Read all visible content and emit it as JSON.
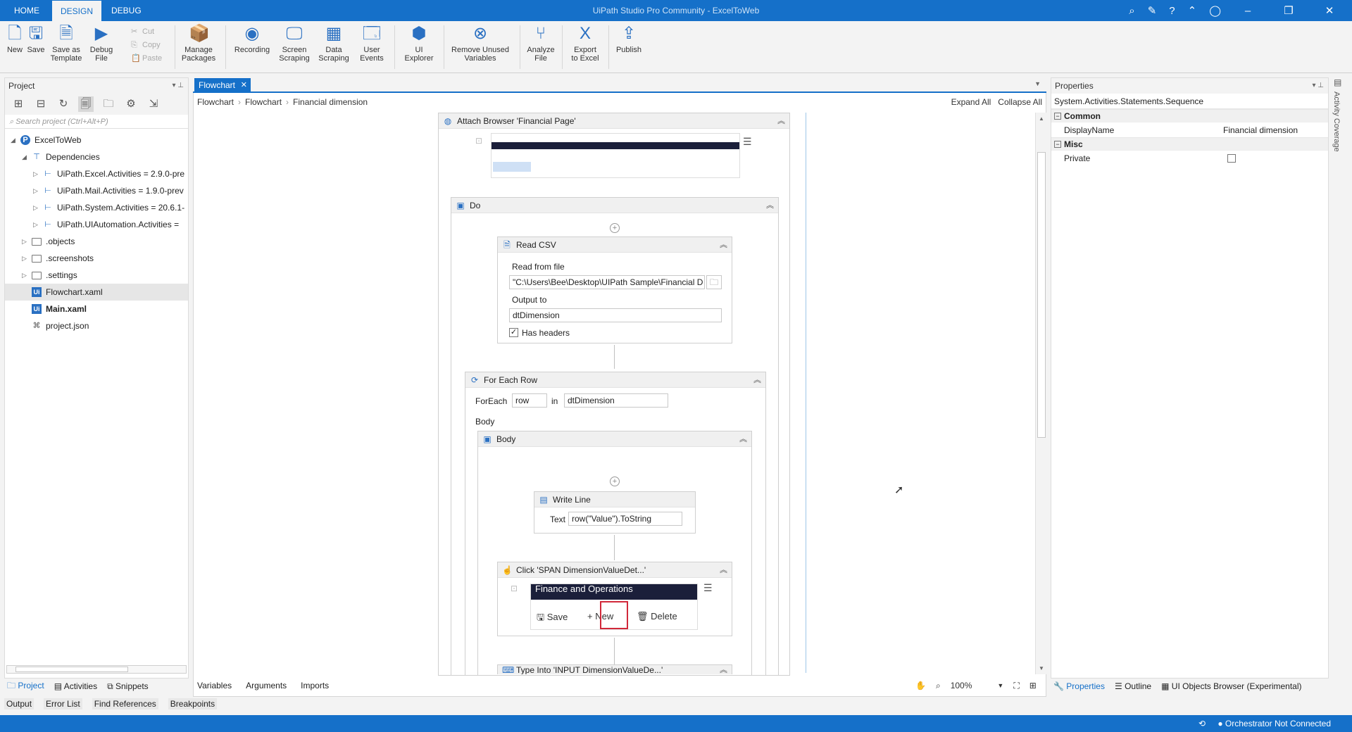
{
  "titlebar": {
    "tabs": [
      "HOME",
      "DESIGN",
      "DEBUG"
    ],
    "title": "UiPath Studio Pro Community - ExcelToWeb"
  },
  "ribbon": {
    "new": "New",
    "save": "Save",
    "save_as_template": "Save as\nTemplate",
    "debug_file": "Debug\nFile",
    "cut": "Cut",
    "copy": "Copy",
    "paste": "Paste",
    "manage_packages": "Manage\nPackages",
    "recording": "Recording",
    "screen_scraping": "Screen\nScraping",
    "data_scraping": "Data\nScraping",
    "user_events": "User\nEvents",
    "ui_explorer": "UI\nExplorer",
    "remove_unused": "Remove Unused\nVariables",
    "analyze_file": "Analyze\nFile",
    "export_excel": "Export\nto Excel",
    "publish": "Publish"
  },
  "project": {
    "header": "Project",
    "search_placeholder": "Search project (Ctrl+Alt+P)",
    "tree": [
      {
        "label": "ExcelToWeb"
      },
      {
        "label": "Dependencies"
      },
      {
        "label": "UiPath.Excel.Activities = 2.9.0-pre"
      },
      {
        "label": "UiPath.Mail.Activities = 1.9.0-prev"
      },
      {
        "label": "UiPath.System.Activities = 20.6.1-"
      },
      {
        "label": "UiPath.UIAutomation.Activities ="
      },
      {
        "label": ".objects"
      },
      {
        "label": ".screenshots"
      },
      {
        "label": ".settings"
      },
      {
        "label": "Flowchart.xaml"
      },
      {
        "label": "Main.xaml"
      },
      {
        "label": "project.json"
      }
    ],
    "bottom_tabs": [
      "Project",
      "Activities",
      "Snippets"
    ]
  },
  "output_tabs": [
    "Output",
    "Error List",
    "Find References",
    "Breakpoints"
  ],
  "designer": {
    "tab": "Flowchart",
    "breadcrumb": [
      "Flowchart",
      "Flowchart",
      "Financial dimension"
    ],
    "expand_all": "Expand All",
    "collapse_all": "Collapse All",
    "attach_browser": "Attach Browser 'Financial Page'",
    "do_label": "Do",
    "read_csv": {
      "title": "Read CSV",
      "read_from_label": "Read from file",
      "read_from_value": "\"C:\\Users\\Bee\\Desktop\\UIPath Sample\\Financial D",
      "output_label": "Output to",
      "output_value": "dtDimension",
      "has_headers": "Has headers"
    },
    "for_each": {
      "title": "For Each Row",
      "foreach_label": "ForEach",
      "foreach_var": "row",
      "in_label": "in",
      "in_value": "dtDimension",
      "body_label": "Body"
    },
    "body_seq": "Body",
    "write_line": {
      "title": "Write Line",
      "text_label": "Text",
      "text_value": "row(\"Value\").ToString"
    },
    "click": {
      "title": "Click 'SPAN  DimensionValueDet...'",
      "banner": "Finance and Operations",
      "save": "Save",
      "new": "New",
      "delete": "Delete"
    },
    "type_into": "Type Into 'INPUT  DimensionValueDe...'",
    "bottom_tabs": [
      "Variables",
      "Arguments",
      "Imports"
    ],
    "zoom": "100%"
  },
  "properties": {
    "header": "Properties",
    "type": "System.Activities.Statements.Sequence",
    "common": "Common",
    "display_name_label": "DisplayName",
    "display_name_value": "Financial dimension",
    "misc": "Misc",
    "private_label": "Private",
    "bottom_tabs": [
      "Properties",
      "Outline",
      "UI Objects Browser (Experimental)"
    ],
    "side_tab": "Activity Coverage"
  },
  "status": {
    "orchestrator": "Orchestrator Not Connected"
  },
  "colors": {
    "accent": "#1570c9",
    "highlight": "#d1283a"
  }
}
